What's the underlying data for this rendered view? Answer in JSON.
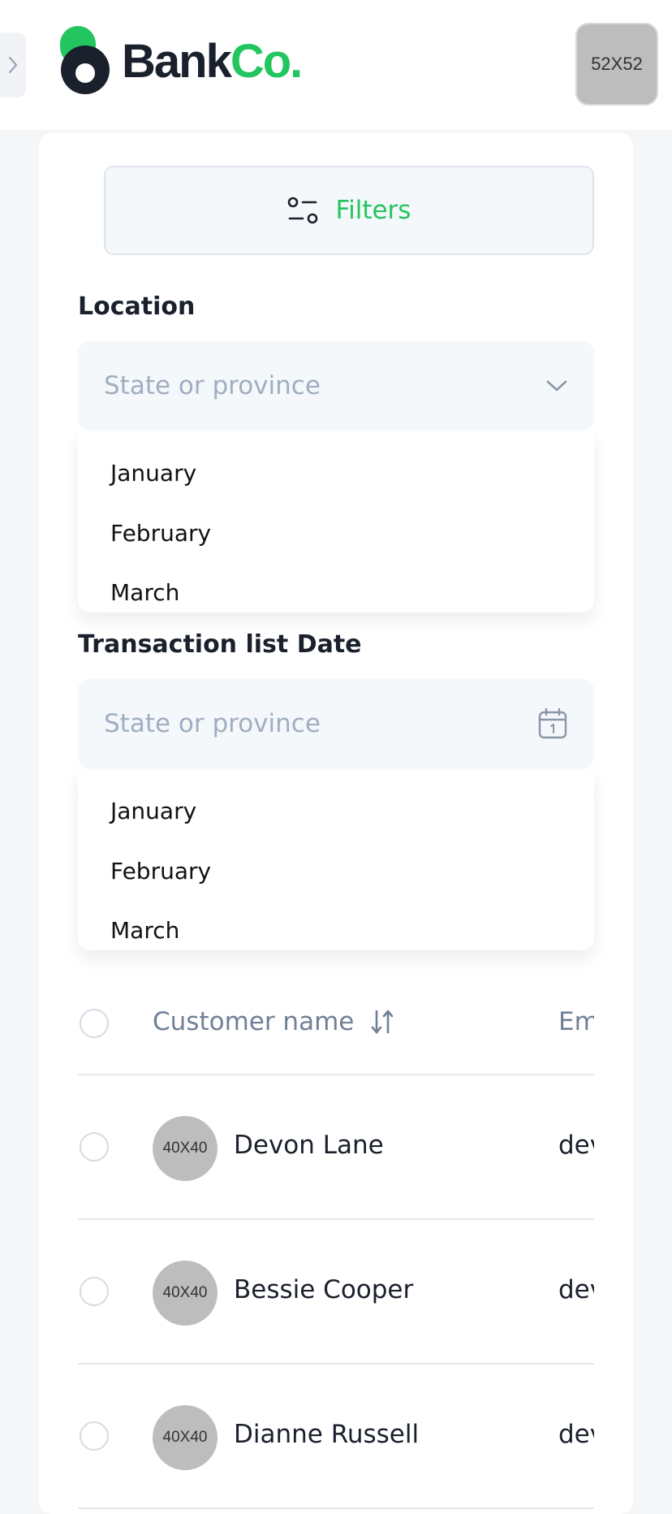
{
  "header": {
    "logo": {
      "bank": "Bank",
      "co": "Co."
    },
    "avatar_placeholder": "52X52"
  },
  "filters": {
    "button_label": "Filters"
  },
  "location": {
    "label": "Location",
    "placeholder": "State or province",
    "options": [
      "January",
      "February",
      "March"
    ]
  },
  "transaction_date": {
    "label": "Transaction list Date",
    "placeholder": "State or province",
    "options": [
      "January",
      "February",
      "March"
    ]
  },
  "table": {
    "columns": {
      "customer_name": "Customer name",
      "email": "Email"
    },
    "rows": [
      {
        "avatar": "40X40",
        "name": "Devon Lane",
        "email": "devon"
      },
      {
        "avatar": "40X40",
        "name": "Bessie Cooper",
        "email": "devon"
      },
      {
        "avatar": "40X40",
        "name": "Dianne Russell",
        "email": "devon"
      }
    ]
  },
  "colors": {
    "brand_green": "#22c55e",
    "text_dark": "#1a202c",
    "muted": "#a0aec0",
    "field_bg": "#f5f8fb"
  }
}
